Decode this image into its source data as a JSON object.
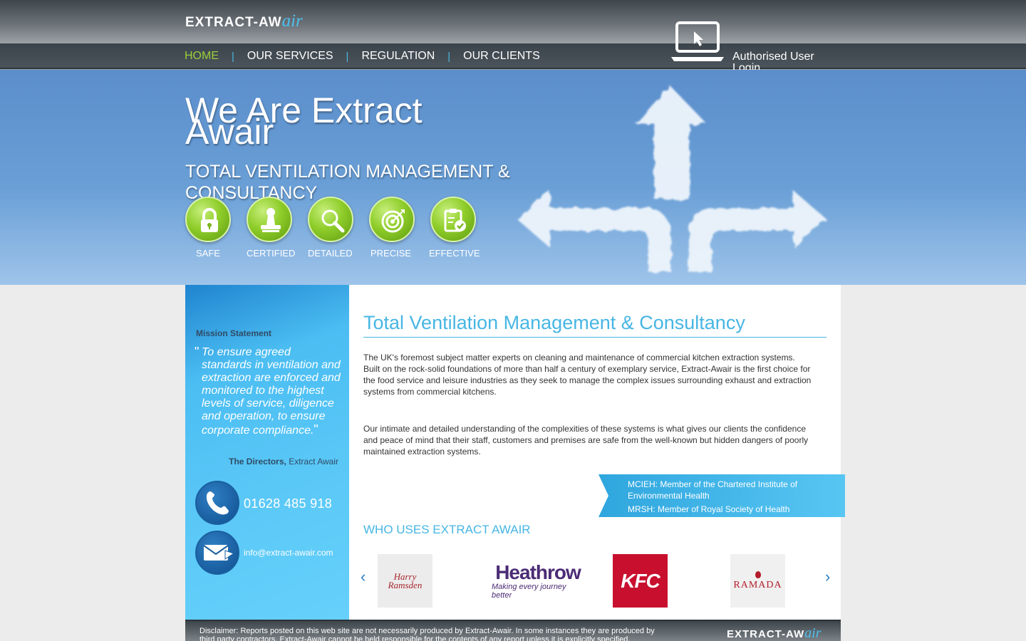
{
  "header": {
    "logo_main": "EXTRACT-AW",
    "logo_accent": "air",
    "nav": [
      "HOME",
      "OUR SERVICES",
      "REGULATION",
      "OUR CLIENTS"
    ],
    "active_nav": "HOME",
    "login_label": "Authorised User Login"
  },
  "hero": {
    "title": "We Are Extract Awair",
    "subtitle": "TOTAL VENTILATION MANAGEMENT & CONSULTANCY",
    "features": [
      "SAFE",
      "CERTIFIED",
      "DETAILED",
      "PRECISE",
      "EFFECTIVE"
    ]
  },
  "sidebar": {
    "mission_title": "Mission Statement",
    "quote": "To ensure agreed standards in ventilation and extraction are enforced and monitored to the highest levels of service, diligence and operation, to ensure corporate compliance.",
    "author_name": "The Directors,",
    "author_org": "Extract Awair",
    "phone": "01628 485 918",
    "email": "info@extract-awair.com"
  },
  "main": {
    "title": "Total Ventilation Management & Consultancy",
    "para1": "The UK's foremost subject matter experts on cleaning and maintenance of commercial kitchen extraction systems.\nBuilt on the rock-solid foundations of more than half a century of exemplary service, Extract-Awair is the first choice for the food service and leisure industries as they seek to manage the complex issues surrounding exhaust and extraction systems from commercial kitchens.",
    "para2": "Our intimate and detailed understanding of the complexities of these systems is what gives our clients the confidence and peace of mind that their staff, customers and premises are safe from the well-known but hidden dangers of poorly maintained extraction systems.",
    "ribbon": [
      "MCIEH: Member of the Chartered Institute of Environmental Health",
      "MRSH: Member of Royal Society of Health"
    ],
    "clients_title": "WHO USES EXTRACT AWAIR",
    "clients": {
      "harry": "Harry Ramsden",
      "heathrow_name": "Heathrow",
      "heathrow_tag": "Making every journey better",
      "kfc": "KFC",
      "ramada": "RAMADA"
    },
    "prev_arrow": "‹",
    "next_arrow": "›"
  },
  "footer": {
    "disclaimer": "Disclaimer: Reports posted on this web site are not necessarily produced by Extract-Awair. In some instances they are produced by third party contractors. Extract-Awair cannot be held responsible for the contents of any report unless it is explicitly specified.",
    "logo_main": "EXTRACT-AW",
    "logo_accent": "air"
  },
  "colors": {
    "accent_blue": "#47b6e4",
    "nav_active": "#9ad03a",
    "feature_green": "#8fcd2a",
    "kfc_red": "#c8102e"
  },
  "icons": [
    "laptop-cursor-icon",
    "padlock-icon",
    "stamp-icon",
    "magnifier-icon",
    "target-icon",
    "clipboard-check-icon",
    "phone-icon",
    "envelope-icon",
    "cloud-arrows-icon"
  ]
}
